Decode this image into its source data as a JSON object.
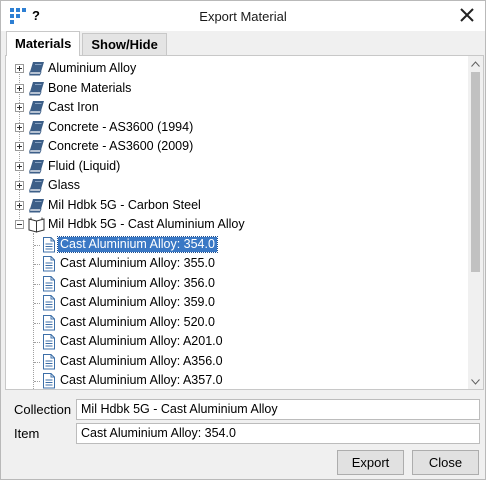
{
  "window": {
    "title": "Export Material",
    "help": "?"
  },
  "tabs": [
    {
      "label": "Materials",
      "active": true
    },
    {
      "label": "Show/Hide",
      "active": false
    }
  ],
  "tree": {
    "categories": [
      "Aluminium Alloy",
      "Bone Materials",
      "Cast Iron",
      "Concrete - AS3600 (1994)",
      "Concrete - AS3600 (2009)",
      "Fluid (Liquid)",
      "Glass",
      "Mil Hdbk 5G - Carbon Steel",
      "Mil Hdbk 5G - Cast Aluminium Alloy"
    ],
    "expanded_category": "Mil Hdbk 5G - Cast Aluminium Alloy",
    "items": [
      "Cast Aluminium Alloy: 354.0",
      "Cast Aluminium Alloy: 355.0",
      "Cast Aluminium Alloy: 356.0",
      "Cast Aluminium Alloy: 359.0",
      "Cast Aluminium Alloy: 520.0",
      "Cast Aluminium Alloy: A201.0",
      "Cast Aluminium Alloy: A356.0",
      "Cast Aluminium Alloy: A357.0"
    ],
    "selected_item": "Cast Aluminium Alloy: 354.0"
  },
  "fields": {
    "collection_label": "Collection",
    "collection_value": "Mil Hdbk 5G - Cast Aluminium Alloy",
    "item_label": "Item",
    "item_value": "Cast Aluminium Alloy: 354.0"
  },
  "buttons": {
    "export": "Export",
    "close": "Close"
  },
  "icons": {
    "app": "grid-app-icon",
    "category": "book-icon",
    "category_open": "open-book-icon",
    "item": "document-icon",
    "close": "close-icon"
  },
  "colors": {
    "selection": "#3a78c5",
    "book": "#3d5f88",
    "app_icon": "#2d7fd3"
  }
}
